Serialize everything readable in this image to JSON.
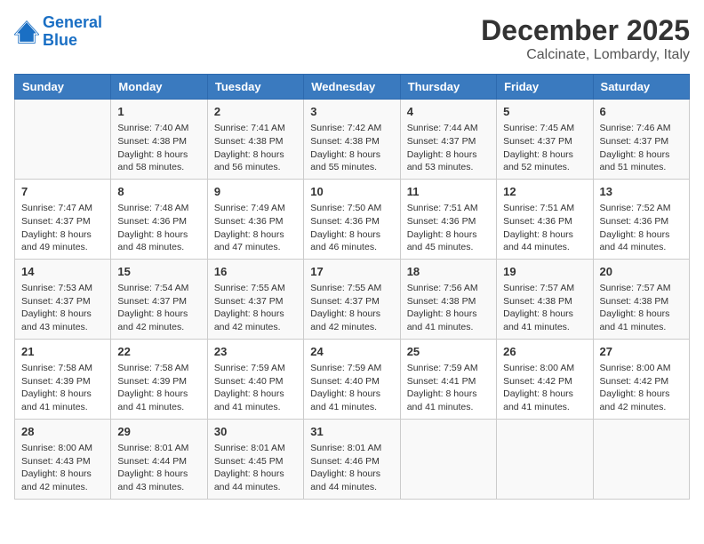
{
  "logo": {
    "line1": "General",
    "line2": "Blue"
  },
  "title": "December 2025",
  "subtitle": "Calcinate, Lombardy, Italy",
  "days_header": [
    "Sunday",
    "Monday",
    "Tuesday",
    "Wednesday",
    "Thursday",
    "Friday",
    "Saturday"
  ],
  "weeks": [
    [
      {
        "day": "",
        "sunrise": "",
        "sunset": "",
        "daylight": ""
      },
      {
        "day": "1",
        "sunrise": "Sunrise: 7:40 AM",
        "sunset": "Sunset: 4:38 PM",
        "daylight": "Daylight: 8 hours and 58 minutes."
      },
      {
        "day": "2",
        "sunrise": "Sunrise: 7:41 AM",
        "sunset": "Sunset: 4:38 PM",
        "daylight": "Daylight: 8 hours and 56 minutes."
      },
      {
        "day": "3",
        "sunrise": "Sunrise: 7:42 AM",
        "sunset": "Sunset: 4:38 PM",
        "daylight": "Daylight: 8 hours and 55 minutes."
      },
      {
        "day": "4",
        "sunrise": "Sunrise: 7:44 AM",
        "sunset": "Sunset: 4:37 PM",
        "daylight": "Daylight: 8 hours and 53 minutes."
      },
      {
        "day": "5",
        "sunrise": "Sunrise: 7:45 AM",
        "sunset": "Sunset: 4:37 PM",
        "daylight": "Daylight: 8 hours and 52 minutes."
      },
      {
        "day": "6",
        "sunrise": "Sunrise: 7:46 AM",
        "sunset": "Sunset: 4:37 PM",
        "daylight": "Daylight: 8 hours and 51 minutes."
      }
    ],
    [
      {
        "day": "7",
        "sunrise": "Sunrise: 7:47 AM",
        "sunset": "Sunset: 4:37 PM",
        "daylight": "Daylight: 8 hours and 49 minutes."
      },
      {
        "day": "8",
        "sunrise": "Sunrise: 7:48 AM",
        "sunset": "Sunset: 4:36 PM",
        "daylight": "Daylight: 8 hours and 48 minutes."
      },
      {
        "day": "9",
        "sunrise": "Sunrise: 7:49 AM",
        "sunset": "Sunset: 4:36 PM",
        "daylight": "Daylight: 8 hours and 47 minutes."
      },
      {
        "day": "10",
        "sunrise": "Sunrise: 7:50 AM",
        "sunset": "Sunset: 4:36 PM",
        "daylight": "Daylight: 8 hours and 46 minutes."
      },
      {
        "day": "11",
        "sunrise": "Sunrise: 7:51 AM",
        "sunset": "Sunset: 4:36 PM",
        "daylight": "Daylight: 8 hours and 45 minutes."
      },
      {
        "day": "12",
        "sunrise": "Sunrise: 7:51 AM",
        "sunset": "Sunset: 4:36 PM",
        "daylight": "Daylight: 8 hours and 44 minutes."
      },
      {
        "day": "13",
        "sunrise": "Sunrise: 7:52 AM",
        "sunset": "Sunset: 4:36 PM",
        "daylight": "Daylight: 8 hours and 44 minutes."
      }
    ],
    [
      {
        "day": "14",
        "sunrise": "Sunrise: 7:53 AM",
        "sunset": "Sunset: 4:37 PM",
        "daylight": "Daylight: 8 hours and 43 minutes."
      },
      {
        "day": "15",
        "sunrise": "Sunrise: 7:54 AM",
        "sunset": "Sunset: 4:37 PM",
        "daylight": "Daylight: 8 hours and 42 minutes."
      },
      {
        "day": "16",
        "sunrise": "Sunrise: 7:55 AM",
        "sunset": "Sunset: 4:37 PM",
        "daylight": "Daylight: 8 hours and 42 minutes."
      },
      {
        "day": "17",
        "sunrise": "Sunrise: 7:55 AM",
        "sunset": "Sunset: 4:37 PM",
        "daylight": "Daylight: 8 hours and 42 minutes."
      },
      {
        "day": "18",
        "sunrise": "Sunrise: 7:56 AM",
        "sunset": "Sunset: 4:38 PM",
        "daylight": "Daylight: 8 hours and 41 minutes."
      },
      {
        "day": "19",
        "sunrise": "Sunrise: 7:57 AM",
        "sunset": "Sunset: 4:38 PM",
        "daylight": "Daylight: 8 hours and 41 minutes."
      },
      {
        "day": "20",
        "sunrise": "Sunrise: 7:57 AM",
        "sunset": "Sunset: 4:38 PM",
        "daylight": "Daylight: 8 hours and 41 minutes."
      }
    ],
    [
      {
        "day": "21",
        "sunrise": "Sunrise: 7:58 AM",
        "sunset": "Sunset: 4:39 PM",
        "daylight": "Daylight: 8 hours and 41 minutes."
      },
      {
        "day": "22",
        "sunrise": "Sunrise: 7:58 AM",
        "sunset": "Sunset: 4:39 PM",
        "daylight": "Daylight: 8 hours and 41 minutes."
      },
      {
        "day": "23",
        "sunrise": "Sunrise: 7:59 AM",
        "sunset": "Sunset: 4:40 PM",
        "daylight": "Daylight: 8 hours and 41 minutes."
      },
      {
        "day": "24",
        "sunrise": "Sunrise: 7:59 AM",
        "sunset": "Sunset: 4:40 PM",
        "daylight": "Daylight: 8 hours and 41 minutes."
      },
      {
        "day": "25",
        "sunrise": "Sunrise: 7:59 AM",
        "sunset": "Sunset: 4:41 PM",
        "daylight": "Daylight: 8 hours and 41 minutes."
      },
      {
        "day": "26",
        "sunrise": "Sunrise: 8:00 AM",
        "sunset": "Sunset: 4:42 PM",
        "daylight": "Daylight: 8 hours and 41 minutes."
      },
      {
        "day": "27",
        "sunrise": "Sunrise: 8:00 AM",
        "sunset": "Sunset: 4:42 PM",
        "daylight": "Daylight: 8 hours and 42 minutes."
      }
    ],
    [
      {
        "day": "28",
        "sunrise": "Sunrise: 8:00 AM",
        "sunset": "Sunset: 4:43 PM",
        "daylight": "Daylight: 8 hours and 42 minutes."
      },
      {
        "day": "29",
        "sunrise": "Sunrise: 8:01 AM",
        "sunset": "Sunset: 4:44 PM",
        "daylight": "Daylight: 8 hours and 43 minutes."
      },
      {
        "day": "30",
        "sunrise": "Sunrise: 8:01 AM",
        "sunset": "Sunset: 4:45 PM",
        "daylight": "Daylight: 8 hours and 44 minutes."
      },
      {
        "day": "31",
        "sunrise": "Sunrise: 8:01 AM",
        "sunset": "Sunset: 4:46 PM",
        "daylight": "Daylight: 8 hours and 44 minutes."
      },
      {
        "day": "",
        "sunrise": "",
        "sunset": "",
        "daylight": ""
      },
      {
        "day": "",
        "sunrise": "",
        "sunset": "",
        "daylight": ""
      },
      {
        "day": "",
        "sunrise": "",
        "sunset": "",
        "daylight": ""
      }
    ]
  ]
}
